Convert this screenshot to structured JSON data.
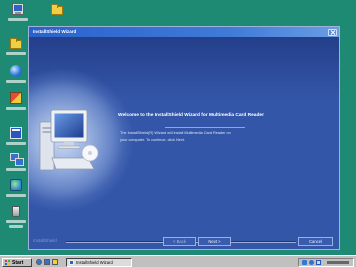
{
  "colors": {
    "desktop": "#1f8a74",
    "title_bar": "#2a62cc",
    "dialog_body": "#3456a8",
    "taskbar": "#c0c0c0"
  },
  "desktop": {
    "icons": [
      "computer-icon",
      "folder-icon",
      "folder-icon",
      "globe-icon",
      "app-icon",
      "app-icon",
      "network-icon",
      "app-icon",
      "recycle-bin-icon"
    ]
  },
  "dialog": {
    "title": "InstallShield Wizard",
    "heading": "Welcome to the InstallShield Wizard for Multimedia Card Reader",
    "message": "The InstallShield(R) Wizard will install Multimedia Card Reader on your computer. To continue, click Next.",
    "brand": "InstallShield",
    "buttons": {
      "back": "< Back",
      "next": "Next >",
      "cancel": "Cancel"
    },
    "icons": {
      "close": "close-icon",
      "illustration": "computer-illustration-icon"
    }
  },
  "taskbar": {
    "start_label": "Start",
    "task_button_label": "InstallShield Wizard",
    "icons": [
      "windows-flag-icon",
      "quick-launch-icon",
      "tray-icon"
    ]
  }
}
